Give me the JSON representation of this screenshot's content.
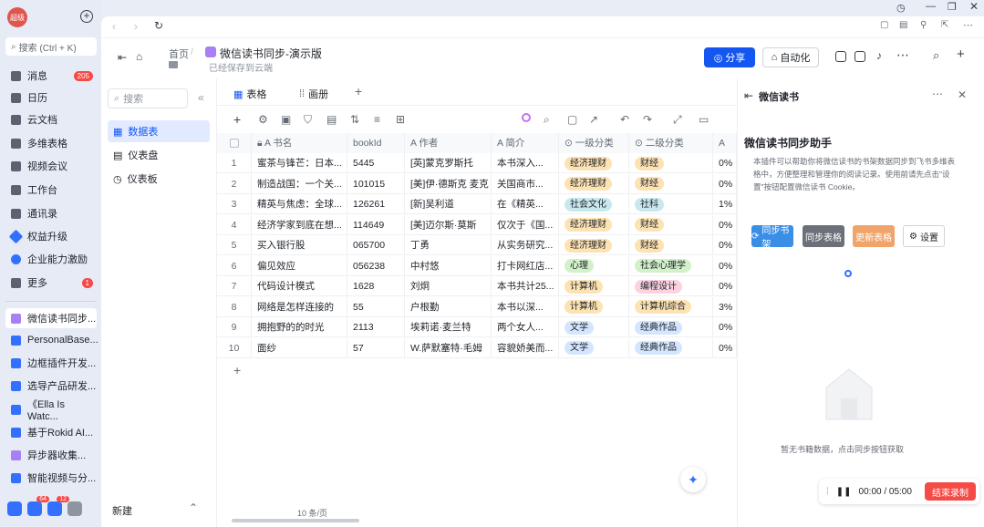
{
  "sidebar": {
    "avatar_text": "超级",
    "search_placeholder": "搜索 (Ctrl + K)",
    "items": [
      {
        "label": "消息",
        "badge": "205"
      },
      {
        "label": "日历",
        "badge": ""
      },
      {
        "label": "云文档",
        "badge": ""
      },
      {
        "label": "多维表格",
        "badge": ""
      },
      {
        "label": "视频会议",
        "badge": ""
      },
      {
        "label": "工作台",
        "badge": ""
      },
      {
        "label": "通讯录",
        "badge": ""
      },
      {
        "label": "权益升级",
        "badge": ""
      },
      {
        "label": "企业能力激励",
        "badge": ""
      },
      {
        "label": "更多",
        "badge": "1"
      }
    ],
    "docs": [
      {
        "label": "微信读书同步...",
        "color": "#a97ff5"
      },
      {
        "label": "PersonalBase...",
        "color": "#3370ff"
      },
      {
        "label": "边框插件开发...",
        "color": "#3370ff"
      },
      {
        "label": "选导产品研发...",
        "color": "#3370ff"
      },
      {
        "label": "《Ella Is Watc...",
        "color": "#3370ff"
      },
      {
        "label": "基于Rokid AI...",
        "color": "#3370ff"
      },
      {
        "label": "异步器收集...",
        "color": "#a97ff5"
      },
      {
        "label": "智能视频与分...",
        "color": "#3370ff"
      }
    ],
    "tray_badges": [
      "64",
      "12"
    ]
  },
  "header": {
    "breadcrumb_root": "首页",
    "doc_title": "微信读书同步-演示版",
    "saved_note": "已经保存到云端",
    "share_label": "分享",
    "auto_label": "自动化"
  },
  "base_panel": {
    "search_placeholder": "搜索",
    "items": [
      "数据表",
      "仪表盘",
      "仪表板"
    ],
    "footer_new": "新建"
  },
  "tabs": {
    "table_tab": "表格",
    "gallery_tab": "画册"
  },
  "table": {
    "headers": [
      "书名",
      "bookId",
      "作者",
      "简介",
      "一级分类",
      "二级分类",
      "字"
    ],
    "rows": [
      {
        "n": "1",
        "title": "蜜茶与锋芒：日本...",
        "id": "5445",
        "author": "[英]蒙克罗斯托",
        "intro": "本书深入...",
        "c1": "经济理财",
        "c2": "财经",
        "x": "0%"
      },
      {
        "n": "2",
        "title": "制造战国：一个关...",
        "id": "101015",
        "author": "[美]伊·德斯克 麦克",
        "intro": "关国商市...",
        "c1": "经济理财",
        "c2": "财经",
        "x": "0%"
      },
      {
        "n": "3",
        "title": "精英与焦虑：全球...",
        "id": "126261",
        "author": "[新]吴利道",
        "intro": "在《精英...",
        "c1": "社会文化",
        "c2": "社科",
        "x": "1%"
      },
      {
        "n": "4",
        "title": "经济学家到底在想...",
        "id": "114649",
        "author": "[美]迈尔斯·莫斯",
        "intro": "仅次于《国...",
        "c1": "经济理财",
        "c2": "财经",
        "x": "0%"
      },
      {
        "n": "5",
        "title": "买入银行股",
        "id": "065700",
        "author": "丁勇",
        "intro": "从实务研究...",
        "c1": "经济理财",
        "c2": "财经",
        "x": "0%"
      },
      {
        "n": "6",
        "title": "偏见效应",
        "id": "056238",
        "author": "中村悠",
        "intro": "打卡网红店...",
        "c1": "心理",
        "c2": "社会心理学",
        "x": "0%"
      },
      {
        "n": "7",
        "title": "代码设计模式",
        "id": "1628",
        "author": "刘炯",
        "intro": "本书共计25...",
        "c1": "计算机",
        "c2": "编程设计",
        "x": "0%"
      },
      {
        "n": "8",
        "title": "网络是怎样连接的",
        "id": "55",
        "author": "户根勤",
        "intro": "本书以深...",
        "c1": "计算机",
        "c2": "计算机综合",
        "x": "3%"
      },
      {
        "n": "9",
        "title": "拥抱野的的时光",
        "id": "2113",
        "author": "埃莉诺·麦兰特",
        "intro": "两个女人...",
        "c1": "文学",
        "c2": "经典作品",
        "x": "0%"
      },
      {
        "n": "10",
        "title": "面纱",
        "id": "57",
        "author": "W.萨默塞特·毛姆",
        "intro": "容貌娇美而...",
        "c1": "文学",
        "c2": "经典作品",
        "x": "0%"
      }
    ],
    "page_size": "10 条/页"
  },
  "plugin": {
    "title": "微信读书",
    "assistant_title": "微信读书同步助手",
    "desc": "本插件可以帮助你将微信读书的书架数据同步到飞书多维表格中，方便整理和管理你的阅读记录。使用前请先点击\"设置\"按钮配置微信读书 Cookie。",
    "btn_sync_books": "同步书架",
    "btn_sync_table": "同步表格",
    "btn_three": "更新表格",
    "btn_settings": "设置",
    "empty_text": "暂无书籍数据，点击同步按钮获取",
    "colors": {
      "blue": "#3a8ee6",
      "gray": "#6b7079",
      "orange": "#f0a46a"
    }
  },
  "recorder": {
    "time": "00:00 / 05:00",
    "stop_label": "结束录制"
  },
  "tag_colors": {
    "经济理财": "#fde2b3",
    "社会文化": "#c9e8ee",
    "心理": "#d2f1c9",
    "计算机": "#fde2b3",
    "文学": "#d4e6ff",
    "财经": "#fde2b3",
    "社科": "#c9e8ee",
    "社会心理学": "#d2f1c9",
    "编程设计": "#fbd3e0",
    "计算机综合": "#fde2b3",
    "经典作品": "#d4e6ff"
  }
}
